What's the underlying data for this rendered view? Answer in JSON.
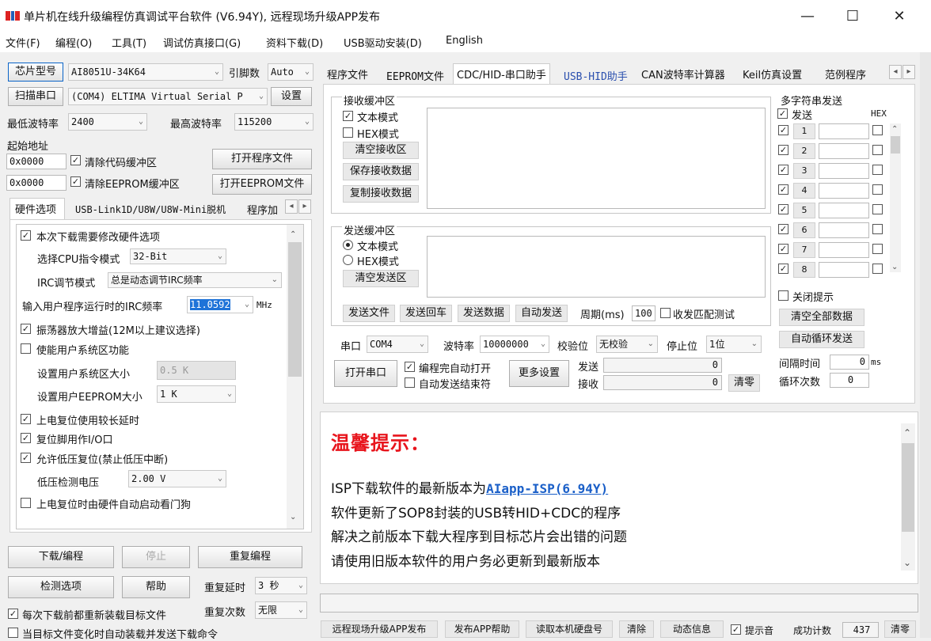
{
  "window": {
    "title": "单片机在线升级编程仿真调试平台软件 (V6.94Y), 远程现场升级APP发布",
    "min": "—",
    "max": "☐",
    "close": "✕"
  },
  "menu": [
    "文件(F)",
    "编程(O)",
    "工具(T)",
    "调试仿真接口(G)",
    "资料下载(D)",
    "USB驱动安装(D)",
    "English"
  ],
  "left": {
    "chip_label": "芯片型号",
    "chip_value": "AI8051U-34K64",
    "pin_label": "引脚数",
    "pin_value": "Auto",
    "scan_label": "扫描串口",
    "port_value": "(COM4) ELTIMA Virtual Serial P",
    "settings_label": "设置",
    "min_baud_label": "最低波特率",
    "min_baud_value": "2400",
    "max_baud_label": "最高波特率",
    "max_baud_value": "115200",
    "start_addr_label": "起始地址",
    "addr1": "0x0000",
    "clear_code": "清除代码缓冲区",
    "open_prog": "打开程序文件",
    "addr2": "0x0000",
    "clear_eeprom": "清除EEPROM缓冲区",
    "open_eeprom": "打开EEPROM文件",
    "tabs": [
      "硬件选项",
      "USB-Link1D/U8W/U8W-Mini脱机",
      "程序加"
    ],
    "options": {
      "modify_hw": "本次下载需要修改硬件选项",
      "cpu_mode_label": "选择CPU指令模式",
      "cpu_mode_value": "32-Bit",
      "irc_label": "IRC调节模式",
      "irc_value": "总是动态调节IRC频率",
      "irc_freq_label": "输入用户程序运行时的IRC频率",
      "irc_freq_value": "11.0592",
      "irc_unit": "MHz",
      "osc_gain": "振荡器放大增益(12M以上建议选择)",
      "enable_sys": "使能用户系统区功能",
      "sys_size_label": "设置用户系统区大小",
      "sys_size_value": "0.5 K",
      "eeprom_size_label": "设置用户EEPROM大小",
      "eeprom_size_value": "1 K",
      "power_delay": "上电复位使用较长延时",
      "reset_io": "复位脚用作I/O口",
      "low_volt_reset": "允许低压复位(禁止低压中断)",
      "low_volt_label": "低压检测电压",
      "low_volt_value": "2.00 V",
      "watchdog": "上电复位时由硬件自动启动看门狗"
    },
    "download": "下载/编程",
    "stop": "停止",
    "reprogram": "重复编程",
    "detect": "检测选项",
    "help": "帮助",
    "repeat_delay_label": "重复延时",
    "repeat_delay_value": "3 秒",
    "repeat_count_label": "重复次数",
    "repeat_count_value": "无限",
    "reload_each": "每次下载前都重新装载目标文件",
    "auto_reload": "当目标文件变化时自动装载并发送下载命令"
  },
  "right": {
    "tabs": [
      "程序文件",
      "EEPROM文件",
      "CDC/HID-串口助手",
      "USB-HID助手",
      "CAN波特率计算器",
      "Keil仿真设置",
      "范例程序"
    ],
    "recv": {
      "title": "接收缓冲区",
      "text_mode": "文本模式",
      "hex_mode": "HEX模式",
      "clear": "清空接收区",
      "save": "保存接收数据",
      "copy": "复制接收数据"
    },
    "send": {
      "title": "发送缓冲区",
      "text_mode": "文本模式",
      "hex_mode": "HEX模式",
      "clear": "清空发送区",
      "send_file": "发送文件",
      "send_cr": "发送回车",
      "send_data": "发送数据",
      "auto_send": "自动发送",
      "period_label": "周期(ms)",
      "period_value": "100",
      "loopback": "收发匹配测试"
    },
    "port_label": "串口",
    "port_value": "COM4",
    "baud_label": "波特率",
    "baud_value": "10000000",
    "parity_label": "校验位",
    "parity_value": "无校验",
    "stop_label": "停止位",
    "stop_value": "1位",
    "open_port": "打开串口",
    "auto_open": "编程完自动打开",
    "auto_end": "自动发送结束符",
    "more": "更多设置",
    "tx_label": "发送",
    "tx_value": "0",
    "rx_label": "接收",
    "rx_value": "0",
    "clear_zero": "清零",
    "multi": {
      "title": "多字符串发送",
      "send_label": "发送",
      "hex_label": "HEX",
      "rows": [
        "1",
        "2",
        "3",
        "4",
        "5",
        "6",
        "7",
        "8"
      ],
      "close_hint": "关闭提示",
      "clear_all": "清空全部数据",
      "auto_loop": "自动循环发送",
      "interval_label": "间隔时间",
      "interval_value": "0",
      "interval_unit": "ms",
      "loop_label": "循环次数",
      "loop_value": "0"
    },
    "notice": {
      "title": "温馨提示：",
      "line1_prefix": "ISP下载软件的最新版本为",
      "line1_link": "AIapp-ISP(6.94Y)",
      "line2": "软件更新了SOP8封装的USB转HID+CDC的程序",
      "line3": "解决之前版本下载大程序到目标芯片会出错的问题",
      "line4": "请使用旧版本软件的用户务必更新到最新版本"
    },
    "bottom": {
      "remote": "远程现场升级APP发布",
      "publish_help": "发布APP帮助",
      "read_serial": "读取本机硬盘号",
      "clear": "清除",
      "status": "动态信息",
      "beep": "提示音",
      "success_label": "成功计数",
      "success_value": "437",
      "clear_zero": "清零"
    }
  }
}
